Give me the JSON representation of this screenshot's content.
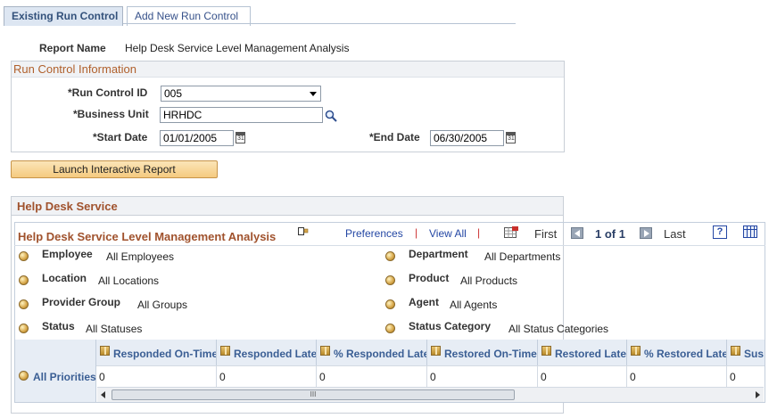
{
  "tabs": [
    {
      "label": "Existing Run Control"
    },
    {
      "label": "Add New Run Control"
    }
  ],
  "report": {
    "label": "Report Name",
    "value": "Help Desk Service Level Management Analysis"
  },
  "run_control": {
    "title": "Run Control Information",
    "run_control_id_label": "*Run Control ID",
    "run_control_id_value": "005",
    "business_unit_label": "*Business Unit",
    "business_unit_value": "HRHDC",
    "start_date_label": "*Start Date",
    "start_date_value": "01/01/2005",
    "end_date_label": "*End Date",
    "end_date_value": "06/30/2005",
    "calendar_glyph": "31"
  },
  "launch_button": "Launch Interactive Report",
  "help_desk": {
    "section_title": "Help Desk Service",
    "grid_title": "Help Desk Service Level Management Analysis",
    "toolbar": {
      "preferences": "Preferences",
      "view_all": "View All",
      "separator": "|",
      "first": "First",
      "page": "1 of 1",
      "last": "Last",
      "help_glyph": "?"
    },
    "filters": [
      {
        "label": "Employee",
        "value": "All Employees"
      },
      {
        "label": "Department",
        "value": "All Departments"
      },
      {
        "label": "Location",
        "value": "All Locations"
      },
      {
        "label": "Product",
        "value": "All Products"
      },
      {
        "label": "Provider Group",
        "value": "All Groups"
      },
      {
        "label": "Agent",
        "value": "All Agents"
      },
      {
        "label": "Status",
        "value": "All Statuses"
      },
      {
        "label": "Status Category",
        "value": "All Status Categories"
      }
    ],
    "columns": [
      "Responded On-Time",
      "Responded Late",
      "% Responded Late",
      "Restored On-Time",
      "Restored Late",
      "% Restored Late",
      "Sus"
    ],
    "row_label": "All Priorities",
    "row_values": [
      "0",
      "0",
      "0",
      "0",
      "0",
      "0",
      "0"
    ],
    "scroll_grip": "III"
  },
  "colors": {
    "section_title": "#a0522d",
    "link": "#2447a4",
    "button_top": "#fbe5b8",
    "button_bottom": "#f5ca7f"
  }
}
